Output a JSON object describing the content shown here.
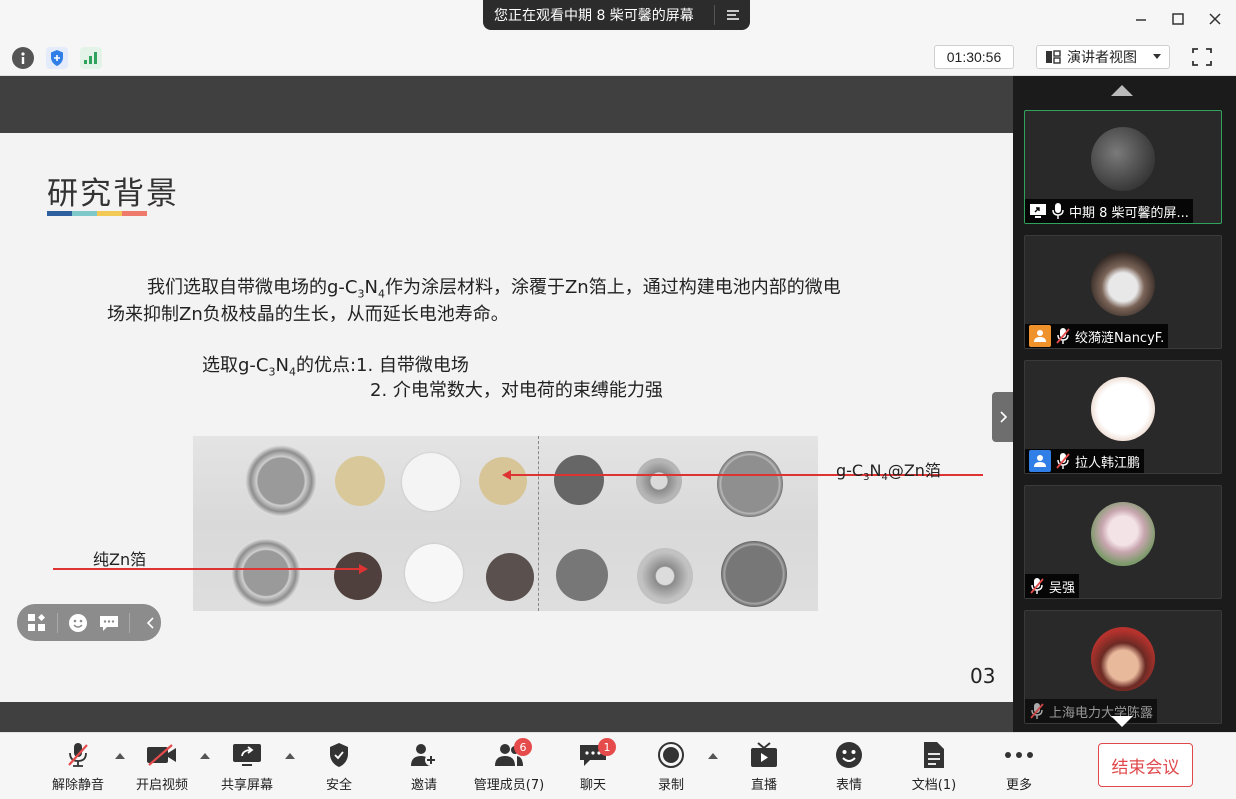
{
  "window": {
    "share_banner": "您正在观看中期 8 柴可馨的屏幕"
  },
  "infobar": {
    "timer": "01:30:56",
    "view_mode": "演讲者视图"
  },
  "slide": {
    "title": "研究背景",
    "title_bar_colors": [
      "#2e5f9e",
      "#7ec8c9",
      "#f2c955",
      "#ee7a6b"
    ],
    "para_line1_pre": "我们选取自带微电场的g-C",
    "para_line1_sub1": "3",
    "para_line1_mid": "N",
    "para_line1_sub2": "4",
    "para_line1_post": "作为涂层材料，涂覆于Zn箔上，通过构建电池内部的微电",
    "para_line2": "场来抑制Zn负极枝晶的生长，从而延长电池寿命。",
    "adv_pre": "选取g-C",
    "adv_sub1": "3",
    "adv_mid": "N",
    "adv_sub2": "4",
    "adv_post": "的优点:1. 自带微电场",
    "adv_line2": "2. 介电常数大，对电荷的束缚能力强",
    "label_right_pre": "g-C",
    "label_right_sub1": "3",
    "label_right_mid": "N",
    "label_right_sub2": "4",
    "label_right_post": "@Zn箔",
    "label_left": "纯Zn箔",
    "page_number": "03"
  },
  "participants": [
    {
      "name": "中期 8 柴可馨的屏...",
      "active": true
    },
    {
      "name": "绞漪涟NancyF.",
      "badge_color": "#f0922b"
    },
    {
      "name": "拉人韩江鹏",
      "badge_color": "#2f7fe6"
    },
    {
      "name": "吴强"
    },
    {
      "name": "上海电力大学陈露"
    }
  ],
  "toolbar": {
    "mute": "解除静音",
    "video": "开启视频",
    "share": "共享屏幕",
    "security": "安全",
    "invite": "邀请",
    "members": "管理成员(7)",
    "members_badge": "6",
    "chat": "聊天",
    "chat_badge": "1",
    "record": "录制",
    "live": "直播",
    "emoji": "表情",
    "docs": "文档(1)",
    "more": "更多",
    "end_meeting": "结束会议"
  }
}
